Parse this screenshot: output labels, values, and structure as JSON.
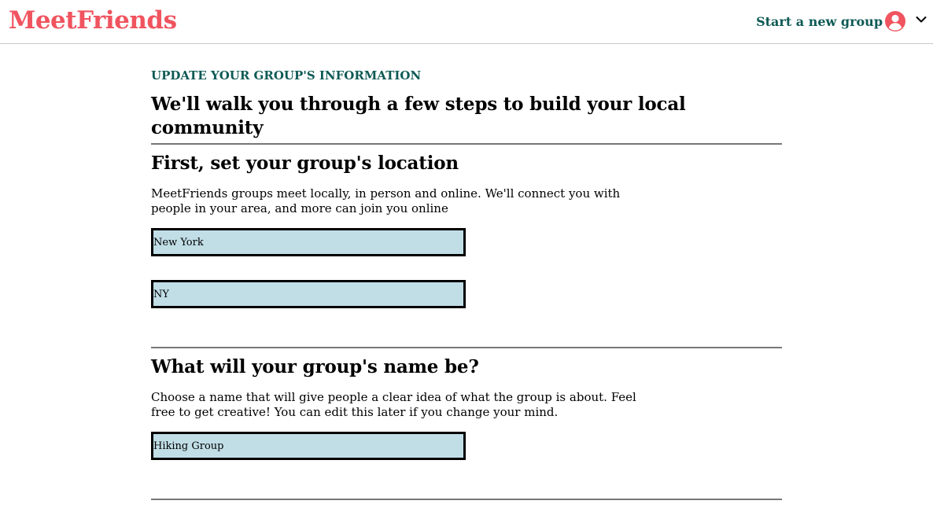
{
  "header": {
    "logo": "MeetFriends",
    "new_group_link": "Start a new group",
    "colors": {
      "logo": "#f0545f",
      "accent": "#0e5a55"
    },
    "icons": {
      "avatar": "user-circle-icon",
      "menu": "chevron-down-icon"
    }
  },
  "page": {
    "kicker": "UPDATE YOUR GROUP'S INFORMATION",
    "title": "We'll walk you through a few steps to build your local community"
  },
  "location_section": {
    "title": "First, set your group's location",
    "description": "MeetFriends groups meet locally, in person and online. We'll connect you with people in your area, and more can join you online",
    "city_value": "New York",
    "state_value": "NY"
  },
  "name_section": {
    "title": "What will your group's name be?",
    "description": "Choose a name that will give people a clear idea of what the group is about. Feel free to get creative! You can edit this later if you change your mind.",
    "name_value": "Hiking Group"
  },
  "field_color": "#c1dee7"
}
